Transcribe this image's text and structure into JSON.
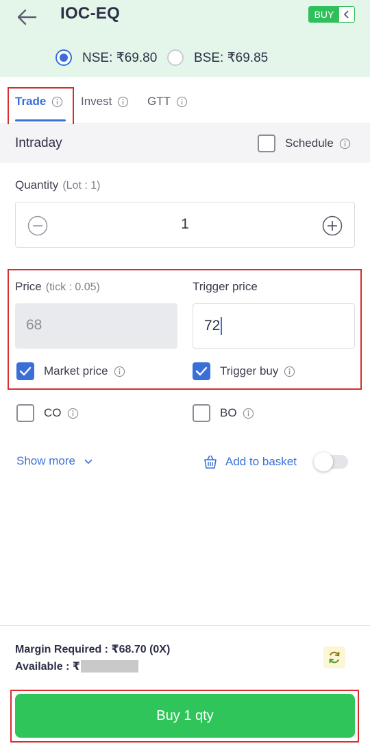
{
  "header": {
    "title": "IOC-EQ",
    "badge_label": "BUY",
    "exchanges": [
      {
        "label": "NSE: ₹69.80",
        "selected": true
      },
      {
        "label": "BSE: ₹69.85",
        "selected": false
      }
    ]
  },
  "tabs": [
    {
      "label": "Trade",
      "active": true
    },
    {
      "label": "Invest",
      "active": false
    },
    {
      "label": "GTT",
      "active": false
    }
  ],
  "order_type": {
    "title": "Intraday",
    "schedule_label": "Schedule",
    "schedule_checked": false
  },
  "quantity": {
    "label": "Quantity",
    "lot": "(Lot : 1)",
    "value": "1"
  },
  "price": {
    "label": "Price",
    "tick": "(tick : 0.05)",
    "value": "68",
    "market_price_label": "Market price",
    "market_price_checked": true
  },
  "trigger": {
    "label": "Trigger price",
    "value": "72",
    "trigger_buy_label": "Trigger buy",
    "trigger_buy_checked": true
  },
  "options": {
    "co_label": "CO",
    "co_checked": false,
    "bo_label": "BO",
    "bo_checked": false
  },
  "actions": {
    "show_more": "Show more",
    "add_to_basket": "Add to basket",
    "basket_toggle_on": false
  },
  "footer": {
    "margin_required": "Margin Required : ₹68.70 (0X)",
    "available": "Available : ₹",
    "buy_button": "Buy 1 qty"
  },
  "colors": {
    "accent": "#3a6fd8",
    "buy_green": "#2fc55a",
    "header_bg": "#e4f6ea",
    "highlight": "#d62d2d"
  }
}
